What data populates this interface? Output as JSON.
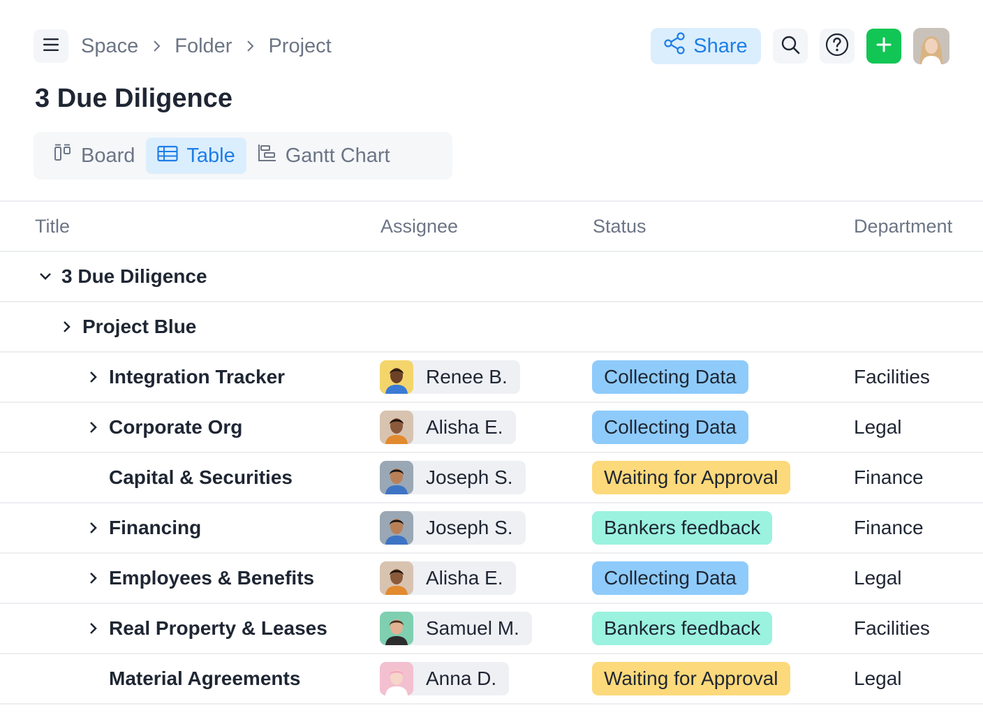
{
  "breadcrumb": {
    "items": [
      "Space",
      "Folder",
      "Project"
    ]
  },
  "header": {
    "share_label": "Share",
    "title": "3 Due Diligence"
  },
  "view_tabs": [
    {
      "label": "Board",
      "icon": "board-icon"
    },
    {
      "label": "Table",
      "icon": "table-icon",
      "active": true
    },
    {
      "label": "Gantt Chart",
      "icon": "gantt-icon"
    }
  ],
  "columns": {
    "title": "Title",
    "assignee": "Assignee",
    "status": "Status",
    "department": "Department"
  },
  "groups": {
    "root": "3 Due Diligence",
    "sub": "Project Blue"
  },
  "status_colors": {
    "Collecting Data": "#8ecbfb",
    "Waiting for Approval": "#fcd97a",
    "Bankers feedback": "#9af2df"
  },
  "rows": [
    {
      "title": "Integration Tracker",
      "expandable": true,
      "assignee": "Renee B.",
      "status": "Collecting Data",
      "department": "Facilities"
    },
    {
      "title": "Corporate Org",
      "expandable": true,
      "assignee": "Alisha E.",
      "status": "Collecting Data",
      "department": "Legal"
    },
    {
      "title": "Capital & Securities",
      "expandable": false,
      "assignee": "Joseph S.",
      "status": "Waiting for Approval",
      "department": "Finance"
    },
    {
      "title": "Financing",
      "expandable": true,
      "assignee": "Joseph S.",
      "status": "Bankers feedback",
      "department": "Finance"
    },
    {
      "title": "Employees & Benefits",
      "expandable": true,
      "assignee": "Alisha E.",
      "status": "Collecting Data",
      "department": "Legal"
    },
    {
      "title": "Real Property & Leases",
      "expandable": true,
      "assignee": "Samuel M.",
      "status": "Bankers feedback",
      "department": "Facilities"
    },
    {
      "title": "Material Agreements",
      "expandable": false,
      "assignee": "Anna D.",
      "status": "Waiting for Approval",
      "department": "Legal"
    }
  ]
}
